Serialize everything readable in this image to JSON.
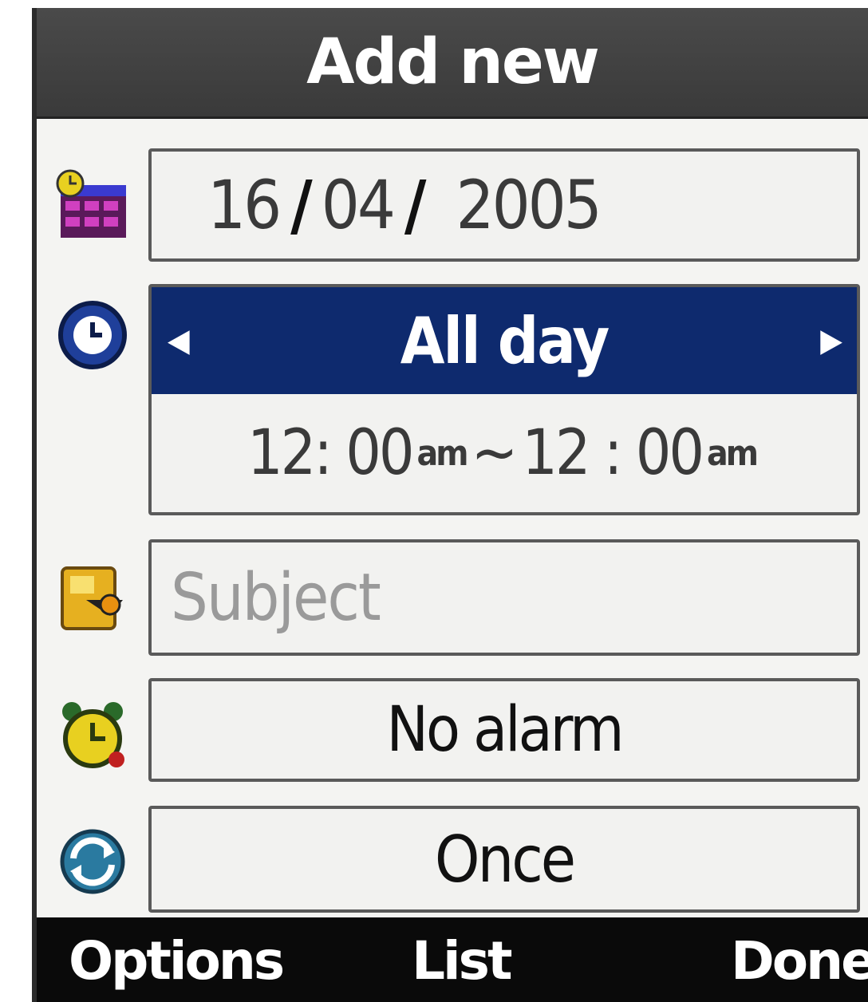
{
  "title": "Add new",
  "date": {
    "day": "16",
    "month": "04",
    "year": "2005"
  },
  "time": {
    "type": "All day",
    "start": "12: 00",
    "start_ampm": "am",
    "separator": "~",
    "end": "12 : 00",
    "end_ampm": "am"
  },
  "subject": {
    "placeholder": "Subject"
  },
  "alarm": {
    "value": "No alarm"
  },
  "repeat": {
    "value": "Once"
  },
  "softkeys": {
    "left": "Options",
    "center": "List",
    "right": "Done"
  },
  "icons": {
    "date": "calendar-icon",
    "time": "clock-icon",
    "subject": "memo-icon",
    "alarm": "alarm-clock-icon",
    "repeat": "repeat-icon"
  },
  "colors": {
    "title_bar": "#3a3a3a",
    "selected": "#0e2a6e",
    "softkey_bar": "#0a0a0a"
  }
}
